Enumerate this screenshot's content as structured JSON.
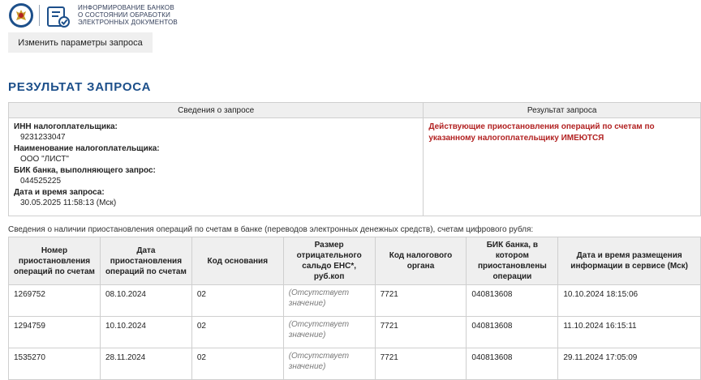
{
  "header": {
    "brand_line1": "ИНФОРМИРОВАНИЕ БАНКОВ",
    "brand_line2": "О СОСТОЯНИИ ОБРАБОТКИ",
    "brand_line3": "ЭЛЕКТРОННЫХ ДОКУМЕНТОВ"
  },
  "toolbar": {
    "change_params_label": "Изменить параметры запроса"
  },
  "page_title": "РЕЗУЛЬТАТ ЗАПРОСА",
  "summary": {
    "col_request_info": "Сведения о запросе",
    "col_result": "Результат запроса",
    "inn_label": "ИНН налогоплательщика:",
    "inn_value": "9231233047",
    "name_label": "Наименование налогоплательщика:",
    "name_value": "ООО \"ЛИСТ\"",
    "bik_label": "БИК банка, выполняющего запрос:",
    "bik_value": "044525225",
    "datetime_label": "Дата и время запроса:",
    "datetime_value": "30.05.2025 11:58:13 (Мск)",
    "result_line1": "Действующие приостановления операций по счетам по",
    "result_line2": "указанному налогоплательщику ИМЕЮТСЯ"
  },
  "accounts_caption": "Сведения о наличии приостановления операций по счетам в банке (переводов электронных денежных средств), счетам цифрового рубля:",
  "accounts": {
    "headers": [
      "Номер приостановления операций по счетам",
      "Дата приостановления операций по счетам",
      "Код основания",
      "Размер отрицательного сальдо ЕНС*, руб.коп",
      "Код налогового органа",
      "БИК банка, в котором приостановлены операции",
      "Дата и время размещения информации в сервисе (Мск)"
    ],
    "rows": [
      [
        "1269752",
        "08.10.2024",
        "02",
        "(Отсутствует значение)",
        "7721",
        "040813608",
        "10.10.2024 18:15:06"
      ],
      [
        "1294759",
        "10.10.2024",
        "02",
        "(Отсутствует значение)",
        "7721",
        "040813608",
        "11.10.2024 16:15:11"
      ],
      [
        "1535270",
        "28.11.2024",
        "02",
        "(Отсутствует значение)",
        "7721",
        "040813608",
        "29.11.2024 17:05:09"
      ]
    ]
  }
}
